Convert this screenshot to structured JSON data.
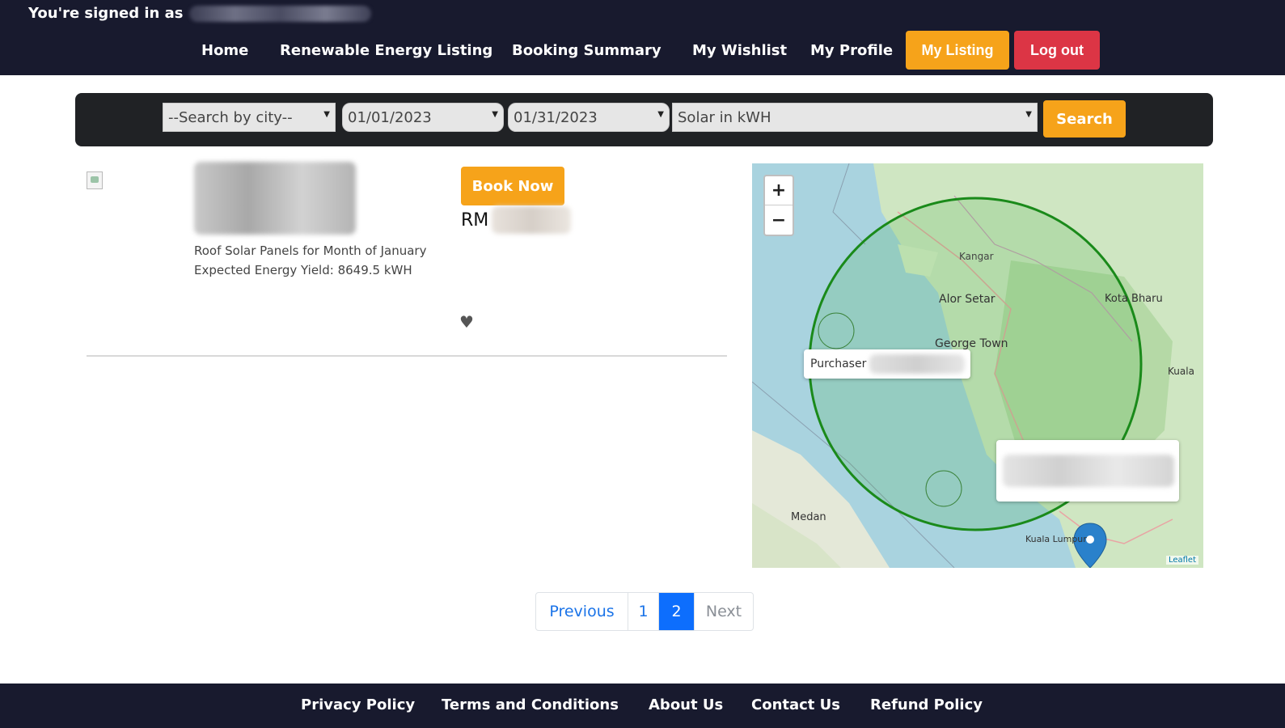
{
  "header": {
    "signed_in_prefix": "You're signed in as",
    "nav": {
      "home": "Home",
      "renewable_energy_listing": "Renewable Energy Listing",
      "booking_summary": "Booking Summary",
      "my_wishlist": "My Wishlist",
      "my_profile": "My Profile",
      "my_listing": "My Listing",
      "log_out": "Log out"
    }
  },
  "search": {
    "city": "--Search by city--",
    "start_date": "01/01/2023",
    "end_date": "01/31/2023",
    "energy_type": "Solar in kWH",
    "button": "Search"
  },
  "listing": {
    "description_line1": "Roof Solar Panels for Month of January",
    "description_line2": "Expected Energy Yield: 8649.5 kWH",
    "book_button": "Book Now",
    "price_prefix": "RM"
  },
  "map": {
    "popup_label": "Purchaser",
    "labels": {
      "kangar": "Kangar",
      "alor_setar": "Alor Setar",
      "george_town": "George Town",
      "kota_bharu": "Kota Bharu",
      "kuala": "Kuala",
      "medan": "Medan",
      "kuala_lumpur": "Kuala Lumpur"
    },
    "attribution": "Leaflet"
  },
  "pagination": {
    "previous": "Previous",
    "page1": "1",
    "page2": "2",
    "next": "Next",
    "current": 2
  },
  "footer": {
    "privacy": "Privacy Policy",
    "terms": "Terms and Conditions",
    "about": "About Us",
    "contact": "Contact Us",
    "refund": "Refund Policy"
  },
  "colors": {
    "nav_bg": "#181a2e",
    "accent_orange": "#f6a31a",
    "logout_red": "#dc3545",
    "page_active": "#0d6efd",
    "circle_green": "#1a8a1a"
  }
}
